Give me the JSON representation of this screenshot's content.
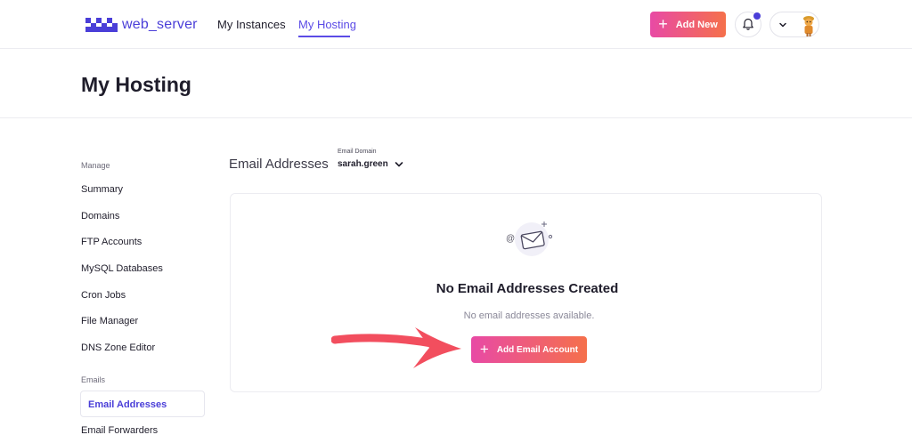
{
  "brand": {
    "name": "web_server"
  },
  "nav": {
    "items": [
      {
        "label": "My Instances",
        "active": false
      },
      {
        "label": "My Hosting",
        "active": true
      }
    ]
  },
  "header_actions": {
    "add_new_label": "Add New",
    "notifications_icon": "bell-icon",
    "user_menu_icon": "chevron-down-icon",
    "avatar_icon": "user-avatar"
  },
  "page": {
    "title": "My Hosting"
  },
  "sidebar": {
    "sections": [
      {
        "title": "Manage",
        "items": [
          "Summary",
          "Domains",
          "FTP Accounts",
          "MySQL Databases",
          "Cron Jobs",
          "File Manager",
          "DNS Zone Editor"
        ]
      },
      {
        "title": "Emails",
        "items": [
          "Email Addresses",
          "Email Forwarders"
        ]
      }
    ],
    "active_item": "Email Addresses"
  },
  "main": {
    "section_title": "Email Addresses",
    "domain_label": "Email Domain",
    "domain_value": "sarah.green",
    "empty_state": {
      "icon": "email-envelope-icon",
      "title": "No Email Addresses Created",
      "subtitle": "No email addresses available.",
      "button_label": "Add Email Account"
    }
  },
  "colors": {
    "accent": "#5b4be6",
    "brand": "#4a3ed8",
    "button_gradient_start": "#e84aa5",
    "button_gradient_end": "#f5704b",
    "annotation_arrow": "#f24e5e"
  }
}
